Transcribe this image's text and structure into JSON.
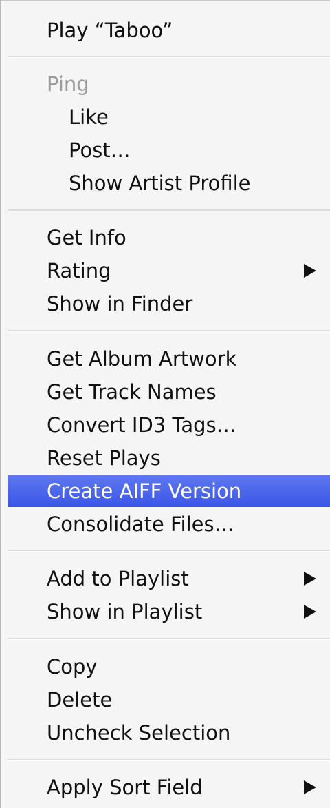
{
  "menu": {
    "groups": [
      {
        "items": [
          {
            "label": "Play “Taboo”"
          }
        ]
      },
      {
        "items": [
          {
            "label": "Ping",
            "disabled": true
          },
          {
            "label": "Like",
            "indent": true
          },
          {
            "label": "Post…",
            "indent": true
          },
          {
            "label": "Show Artist Profile",
            "indent": true
          }
        ]
      },
      {
        "items": [
          {
            "label": "Get Info"
          },
          {
            "label": "Rating",
            "submenu": true
          },
          {
            "label": "Show in Finder"
          }
        ]
      },
      {
        "items": [
          {
            "label": "Get Album Artwork"
          },
          {
            "label": "Get Track Names"
          },
          {
            "label": "Convert ID3 Tags…"
          },
          {
            "label": "Reset Plays"
          },
          {
            "label": "Create AIFF Version",
            "highlighted": true
          },
          {
            "label": "Consolidate Files…"
          }
        ]
      },
      {
        "items": [
          {
            "label": "Add to Playlist",
            "submenu": true
          },
          {
            "label": "Show in Playlist",
            "submenu": true
          }
        ]
      },
      {
        "items": [
          {
            "label": "Copy"
          },
          {
            "label": "Delete"
          },
          {
            "label": "Uncheck Selection"
          }
        ]
      },
      {
        "items": [
          {
            "label": "Apply Sort Field",
            "submenu": true
          }
        ]
      }
    ],
    "highlight_color": "#4a66ec",
    "disabled_color": "#9b9b9b"
  }
}
